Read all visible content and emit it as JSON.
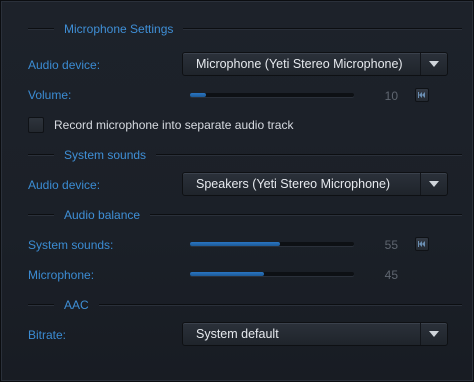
{
  "microphone_settings": {
    "title": "Microphone Settings",
    "audio_device_label": "Audio device:",
    "audio_device_value": "Microphone (Yeti Stereo Microphone)",
    "volume_label": "Volume:",
    "volume_value": "10",
    "volume_fraction": 0.1,
    "record_separate_label": "Record microphone into separate audio track",
    "record_separate_checked": false
  },
  "system_sounds": {
    "title": "System sounds",
    "audio_device_label": "Audio device:",
    "audio_device_value": "Speakers (Yeti Stereo Microphone)"
  },
  "audio_balance": {
    "title": "Audio balance",
    "system_sounds_label": "System sounds:",
    "system_sounds_value": "55",
    "system_sounds_fraction": 0.55,
    "microphone_label": "Microphone:",
    "microphone_value": "45",
    "microphone_fraction": 0.45
  },
  "aac": {
    "title": "AAC",
    "bitrate_label": "Bitrate:",
    "bitrate_value": "System default"
  },
  "colors": {
    "accent": "#3b8cd3",
    "slider_fill": "#2a76c2",
    "background": "#1d222a"
  }
}
